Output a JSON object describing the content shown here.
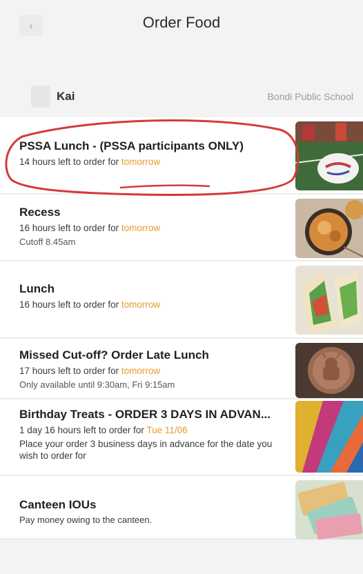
{
  "header": {
    "title": "Order Food",
    "back_icon": "chevron-left-icon"
  },
  "student": {
    "name": "Kai",
    "school": "Bondi Public School"
  },
  "items": [
    {
      "title": "PSSA Lunch - (PSSA participants ONLY)",
      "time_prefix": "14 hours left to order for ",
      "time_day": "tomorrow",
      "sub": ""
    },
    {
      "title": "Recess",
      "time_prefix": "16 hours left to order for ",
      "time_day": "tomorrow",
      "sub": "Cutoff 8.45am"
    },
    {
      "title": "Lunch",
      "time_prefix": "16 hours left to order for ",
      "time_day": "tomorrow",
      "sub": ""
    },
    {
      "title": "Missed Cut-off? Order Late Lunch",
      "time_prefix": "17 hours left to order for ",
      "time_day": "tomorrow",
      "sub": "Only available until 9:30am, Fri 9:15am"
    },
    {
      "title": "Birthday Treats - ORDER 3 DAYS IN ADVAN...",
      "time_prefix": "1 day 16 hours left to order for ",
      "time_day": "Tue 11/06",
      "sub": "Place your order 3 business days in advance for the date you wish to order for"
    },
    {
      "title": "Canteen IOUs",
      "time_prefix": "",
      "time_day": "",
      "sub": "Pay money owing to the canteen."
    }
  ],
  "colors": {
    "accent": "#e79a2e",
    "annotation": "#d43a3a"
  }
}
